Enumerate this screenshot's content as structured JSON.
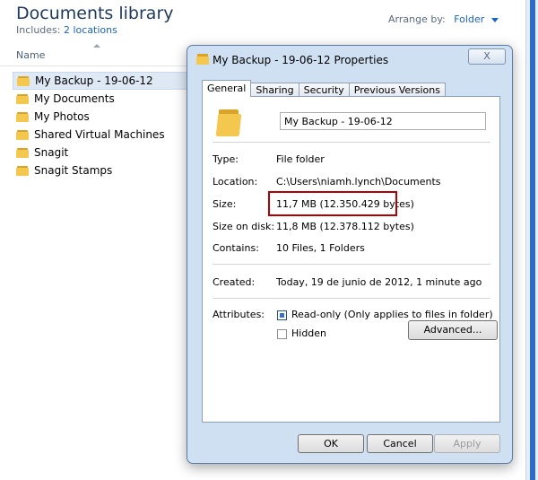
{
  "explorer": {
    "title": "Documents library",
    "includes_label": "Includes:",
    "includes_link": "2 locations",
    "arrange_label": "Arrange by:",
    "arrange_value": "Folder",
    "column_name": "Name",
    "files": [
      "My Backup - 19-06-12",
      "My Documents",
      "My Photos",
      "Shared Virtual Machines",
      "Snagit",
      "Snagit Stamps"
    ]
  },
  "dialog": {
    "title": "My Backup - 19-06-12 Properties",
    "close_label": "X",
    "tabs": [
      "General",
      "Sharing",
      "Security",
      "Previous Versions"
    ],
    "name_value": "My Backup - 19-06-12",
    "type_label": "Type:",
    "type_value": "File folder",
    "location_label": "Location:",
    "location_value": "C:\\Users\\niamh.lynch\\Documents",
    "size_label": "Size:",
    "size_value": "11,7 MB (12.350.429 bytes)",
    "size_on_disk_label": "Size on disk:",
    "size_on_disk_value": "11,8 MB (12.378.112 bytes)",
    "contains_label": "Contains:",
    "contains_value": "10 Files, 1 Folders",
    "created_label": "Created:",
    "created_value": "Today, 19 de junio de 2012, 1 minute ago",
    "attributes_label": "Attributes:",
    "readonly_label": "Read-only (Only applies to files in folder)",
    "hidden_label": "Hidden",
    "advanced_label": "Advanced...",
    "ok_label": "OK",
    "cancel_label": "Cancel",
    "apply_label": "Apply",
    "readonly_checked": true,
    "hidden_checked": false
  }
}
